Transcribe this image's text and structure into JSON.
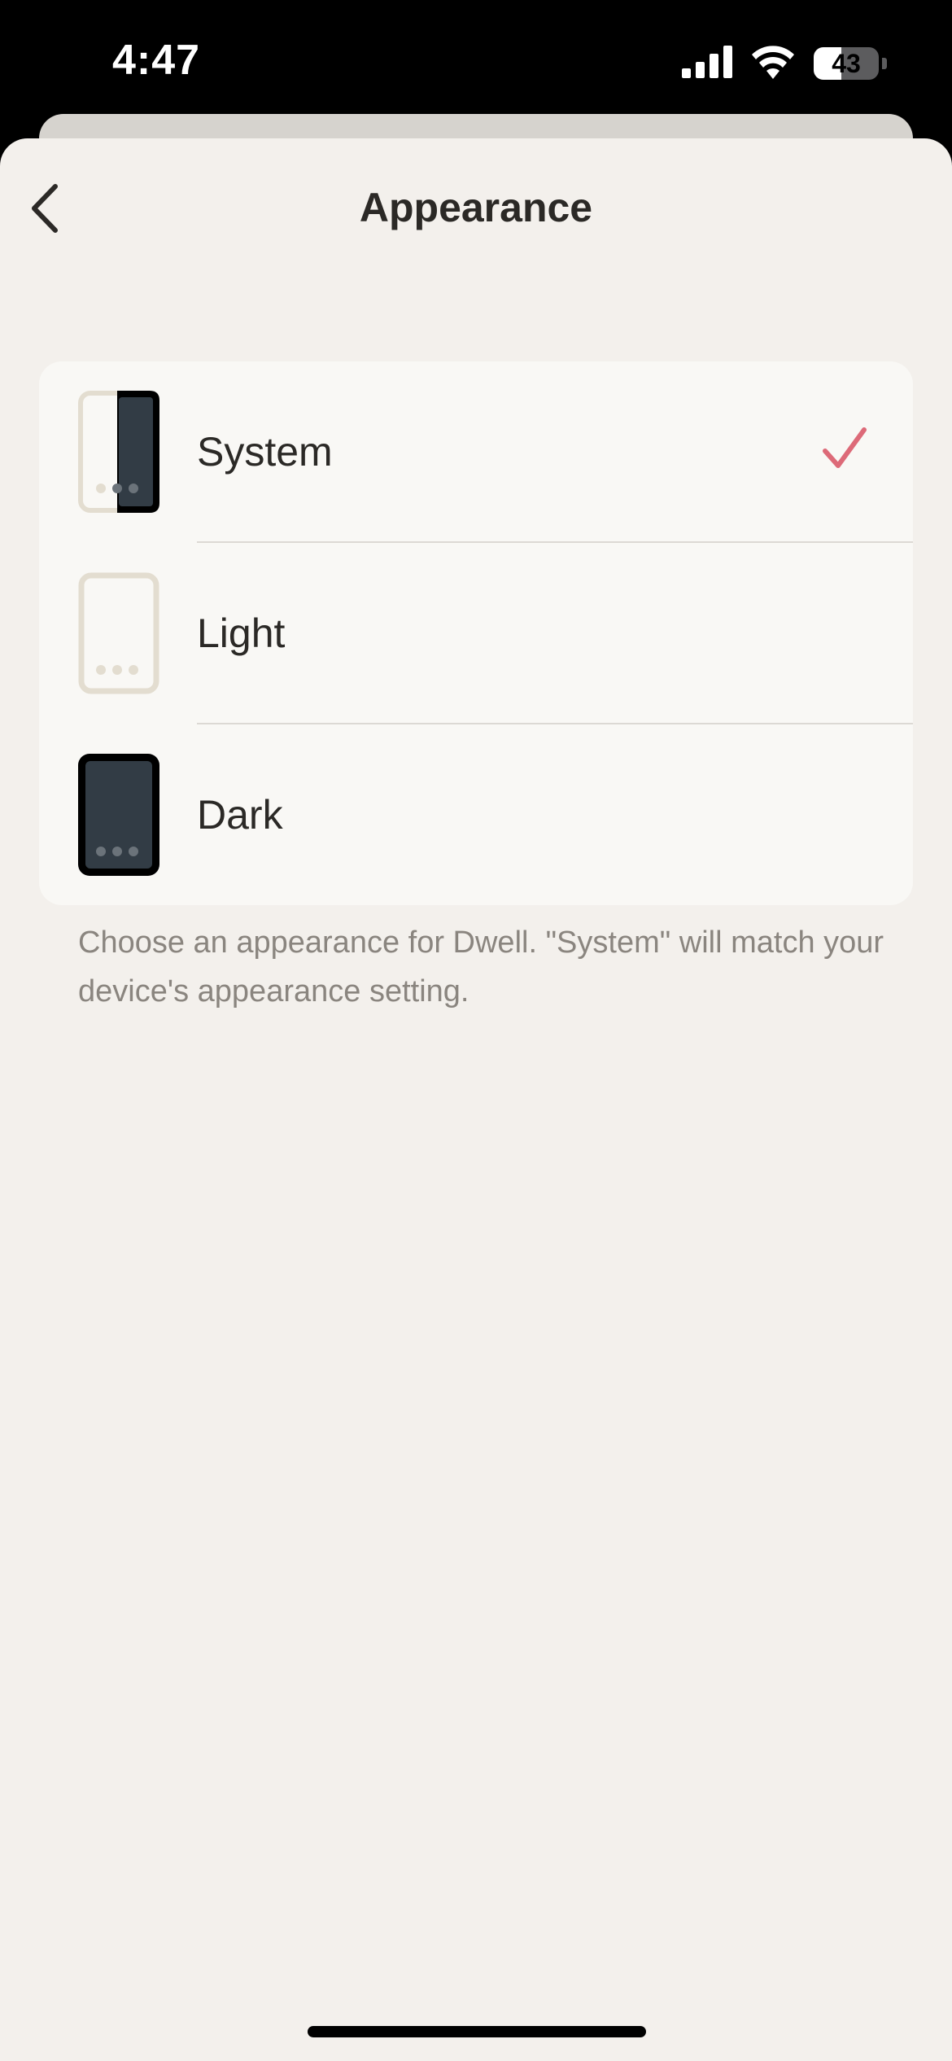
{
  "status_bar": {
    "time": "4:47",
    "battery_level": "43",
    "battery_fraction": 0.43,
    "icons": [
      "cellular-signal-icon",
      "wifi-icon",
      "battery-icon"
    ]
  },
  "header": {
    "title": "Appearance",
    "back_icon": "chevron-left-icon"
  },
  "appearance_options": [
    {
      "label": "System",
      "selected": true,
      "thumb_icon": "phone-split-theme-icon"
    },
    {
      "label": "Light",
      "selected": false,
      "thumb_icon": "phone-light-theme-icon"
    },
    {
      "label": "Dark",
      "selected": false,
      "thumb_icon": "phone-dark-theme-icon"
    }
  ],
  "footer_note": "Choose an appearance for Dwell. \"System\" will match your device's appearance setting.",
  "colors": {
    "background": "#f3f0ec",
    "card": "#f9f8f5",
    "accent_check": "#dd6a78",
    "title_text": "#2b2926",
    "secondary_text": "#8a857f",
    "light_thumb_outline": "#e3ddd0",
    "dark_thumb_fill": "#323c45"
  }
}
